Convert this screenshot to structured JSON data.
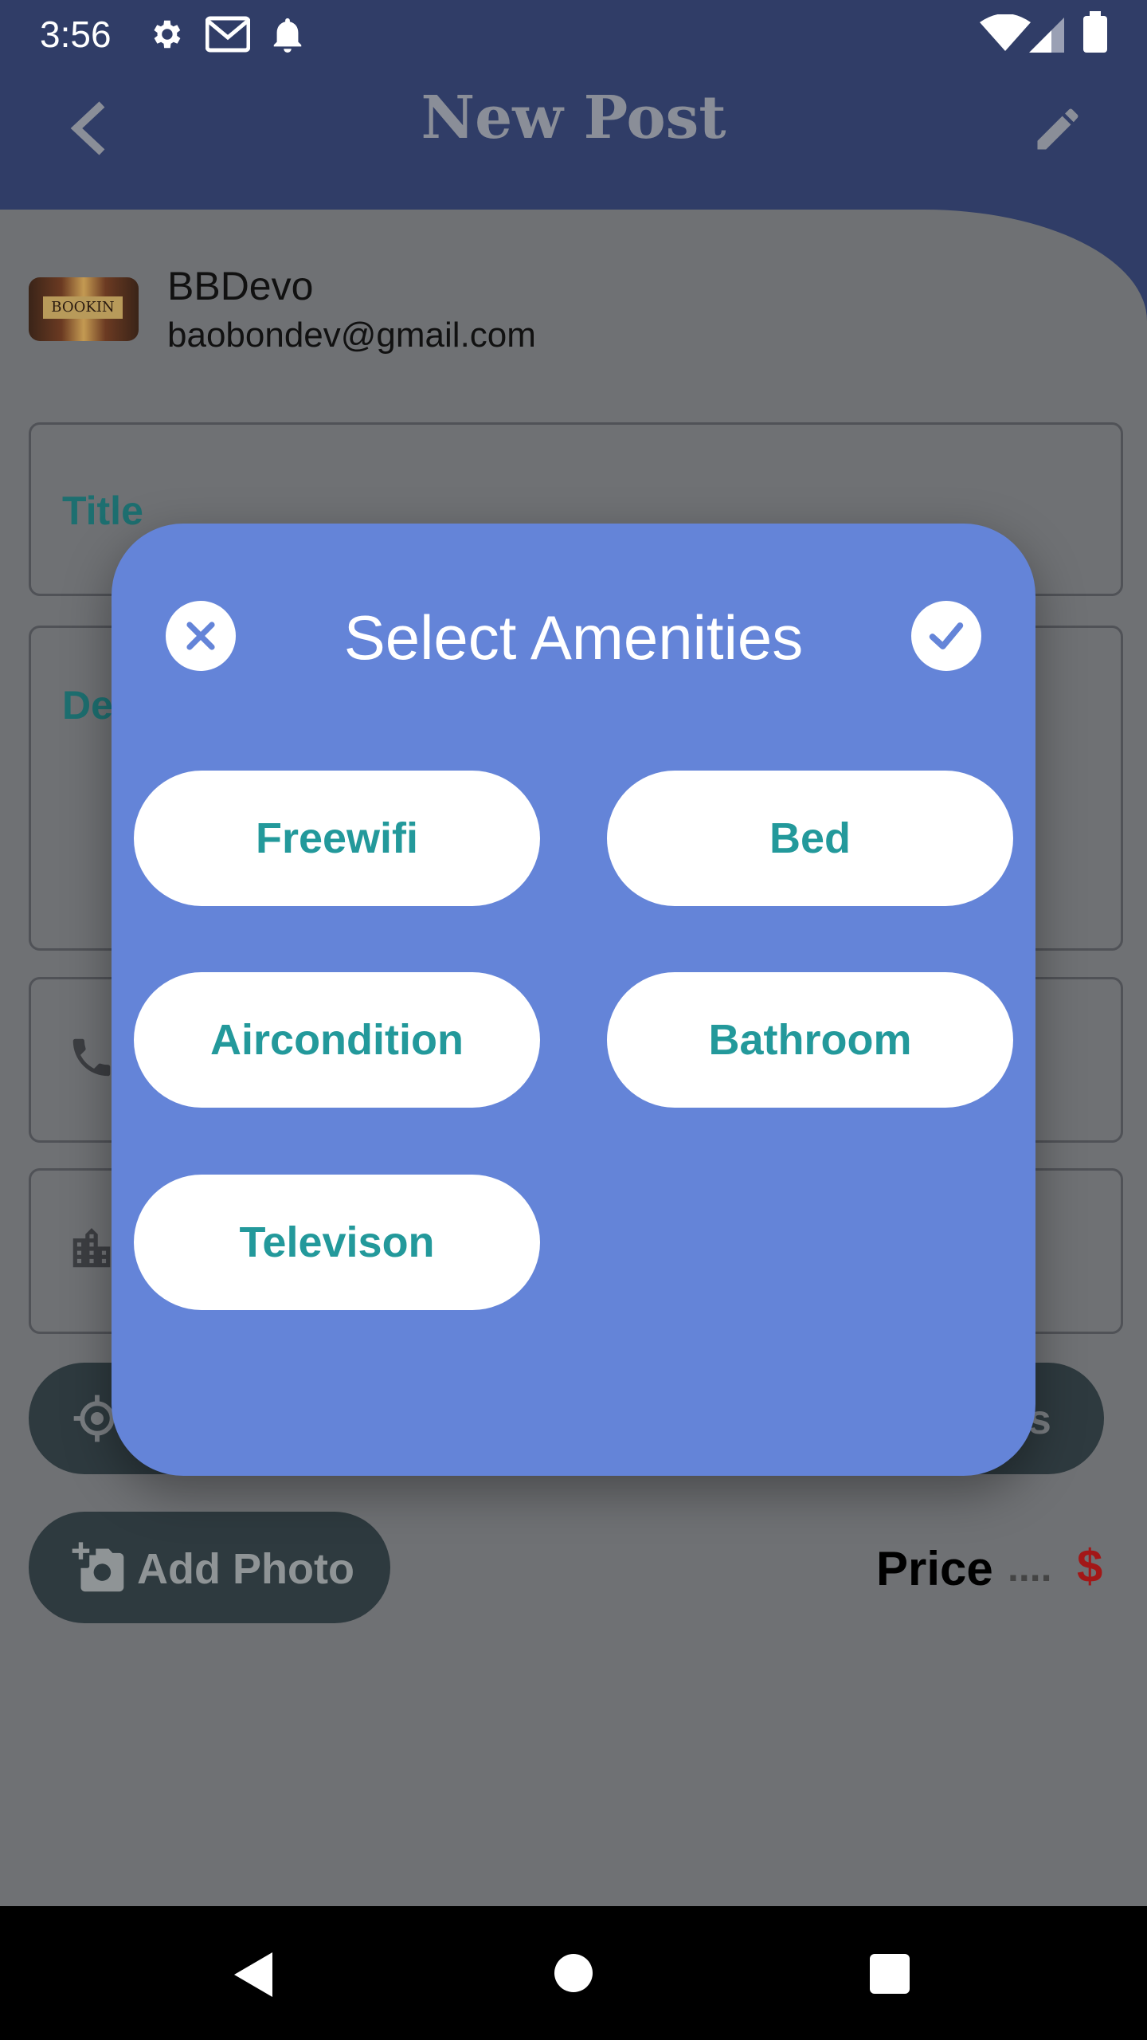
{
  "status_bar": {
    "time": "3:56"
  },
  "app_bar": {
    "title": "New Post"
  },
  "user": {
    "name": "BBDevo",
    "email": "baobondev@gmail.com",
    "avatar_text": "BOOKIN"
  },
  "form": {
    "title_label": "Title",
    "description_label_partial": "De",
    "location_btn_partial": "",
    "amenities_btn_partial": "es",
    "add_photo_label": "Add Photo",
    "price_label": "Price",
    "price_dots": "....",
    "price_currency": "$"
  },
  "dialog": {
    "title": "Select Amenities",
    "amenities": [
      "Freewifi",
      "Bed",
      "Aircondition",
      "Bathroom",
      "Televison"
    ]
  },
  "colors": {
    "app_bar": "#303d67",
    "dialog_bg": "#6484d8",
    "chip_text": "#23999b",
    "price_currency": "#a31717"
  }
}
